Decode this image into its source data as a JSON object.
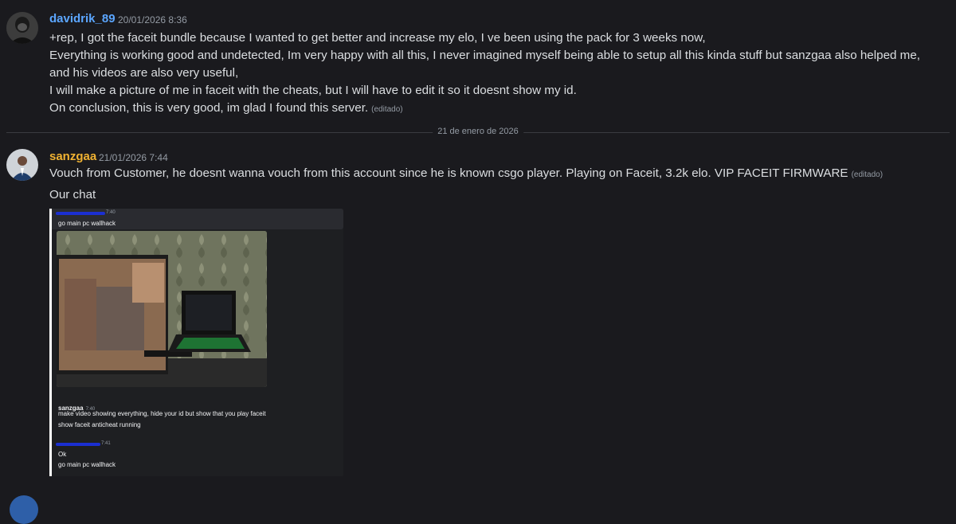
{
  "messages": [
    {
      "username": "davidrik_89",
      "username_color": "#5ba6ff",
      "timestamp": "20/01/2026 8:36",
      "lines": [
        "+rep, I got the faceit bundle because I wanted to get better and increase my elo, I ve been using the pack for 3 weeks now,",
        "Everything is working good and undetected, Im very happy with all this, I never imagined myself being able to setup all this kinda stuff but sanzgaa also helped me, and his videos are also very useful,",
        "I will make a picture of me in faceit with the cheats, but I will have to edit it so it doesnt show my id.",
        "On conclusion, this is very good, im glad I found this server."
      ],
      "edited_label": "(editado)"
    },
    {
      "username": "sanzgaa",
      "username_color": "#f0b232",
      "timestamp": "21/01/2026 7:44",
      "line1": "Vouch from Customer, he doesnt wanna vouch from this account since he is known csgo player. Playing on Faceit, 3.2k elo. VIP FACEIT FIRMWARE",
      "edited_label": "(editado)",
      "line2": "Our chat"
    }
  ],
  "date_divider": "21 de enero de 2026",
  "embedded_chat": {
    "first_time": "7:40",
    "first_text": "go main pc wallhack",
    "reply_name": "sanzgaa",
    "reply_time": "7:40",
    "reply_lines": [
      "make video showing everything, hide your id but show that you play faceit",
      "show faceit anticheat running"
    ],
    "last_time": "7:41",
    "last_lines": [
      "Ok",
      "go main pc wallhack"
    ]
  }
}
